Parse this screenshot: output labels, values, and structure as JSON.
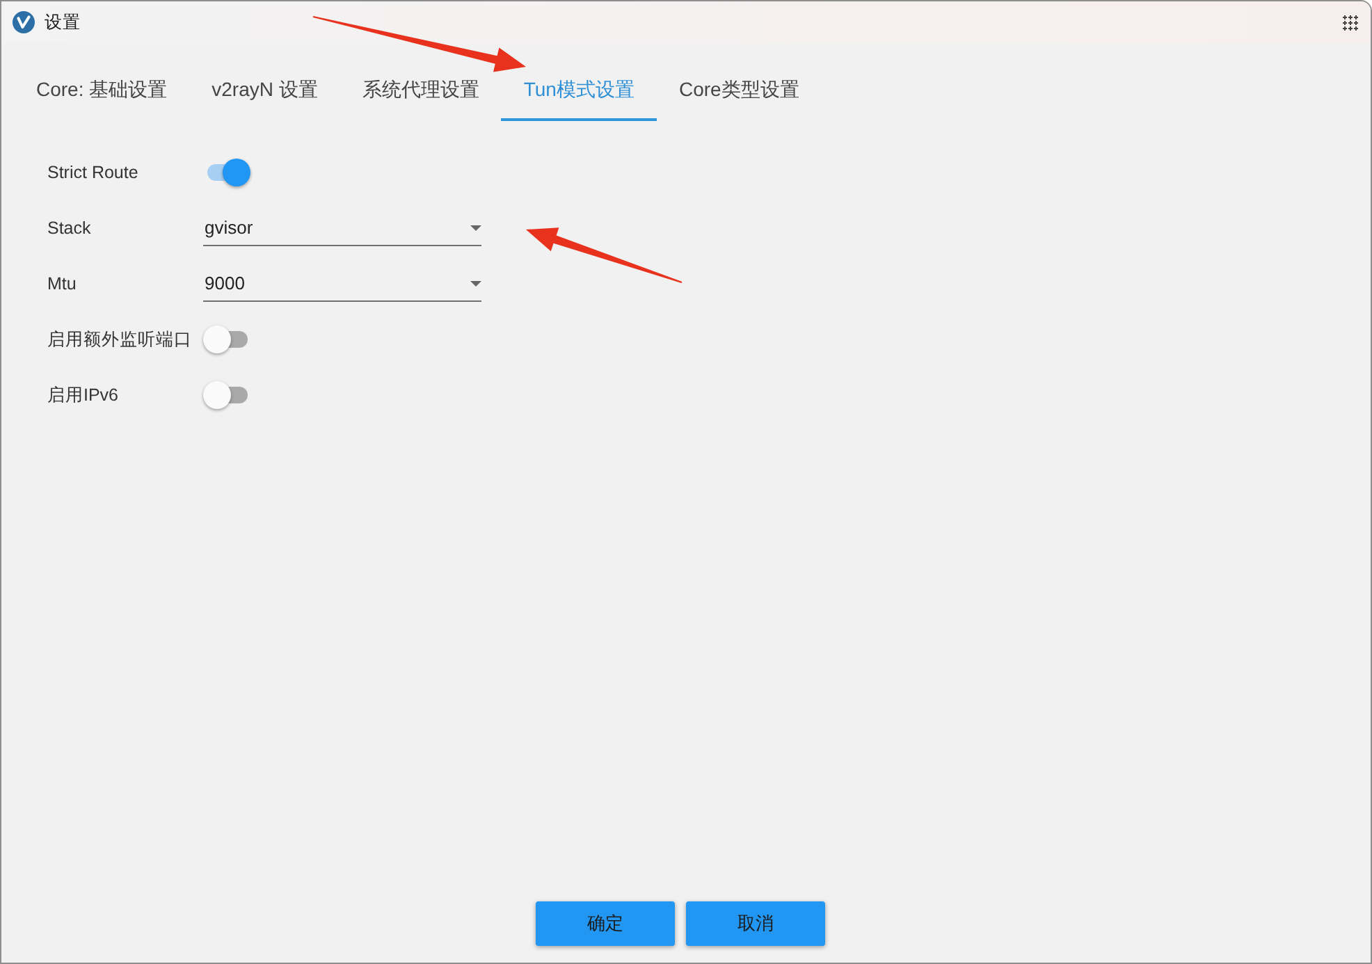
{
  "window": {
    "title": "设置"
  },
  "tabs": [
    {
      "label": "Core: 基础设置",
      "selected": false
    },
    {
      "label": "v2rayN 设置",
      "selected": false
    },
    {
      "label": "系统代理设置",
      "selected": false
    },
    {
      "label": "Tun模式设置",
      "selected": true
    },
    {
      "label": "Core类型设置",
      "selected": false
    }
  ],
  "settings": [
    {
      "kind": "toggle",
      "label": "Strict Route",
      "on": true
    },
    {
      "kind": "dropdown",
      "label": "Stack",
      "value": "gvisor"
    },
    {
      "kind": "dropdown",
      "label": "Mtu",
      "value": "9000"
    },
    {
      "kind": "toggle",
      "label": "启用额外监听端口",
      "on": false
    },
    {
      "kind": "toggle",
      "label": "启用IPv6",
      "on": false
    }
  ],
  "buttons": [
    "确定",
    "取消"
  ]
}
